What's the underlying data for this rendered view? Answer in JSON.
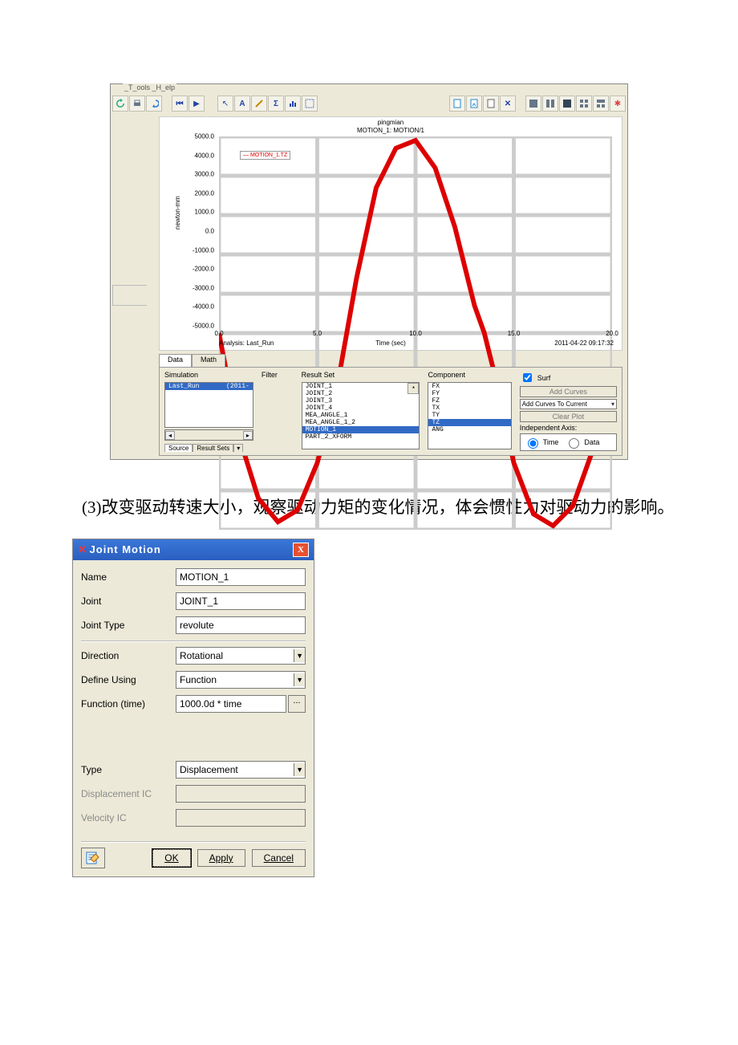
{
  "menufrag": "_T_ools  _H_elp",
  "chart_data": {
    "type": "line",
    "title": "pingmian",
    "subtitle": "MOTION_1: MOTION/1",
    "xlabel": "Time (sec)",
    "ylabel": "newton-mm",
    "xlim": [
      0,
      20
    ],
    "ylim": [
      -5000,
      5000
    ],
    "xticks": [
      0.0,
      5.0,
      10.0,
      15.0,
      20.0
    ],
    "yticks": [
      -5000.0,
      -4000.0,
      -3000.0,
      -2000.0,
      -1000.0,
      0.0,
      1000.0,
      2000.0,
      3000.0,
      4000.0,
      5000.0
    ],
    "series": [
      {
        "name": "MOTION_1.TZ",
        "color": "#d00000",
        "x": [
          0,
          1,
          2,
          3,
          4,
          5,
          6,
          6.5,
          7,
          8,
          9,
          10,
          11,
          12,
          13,
          13.5,
          14,
          15,
          16,
          17,
          18,
          19,
          20
        ],
        "y": [
          0,
          -2600,
          -4200,
          -4800,
          -4500,
          -3300,
          -1400,
          0,
          1400,
          3700,
          4700,
          4900,
          4200,
          2700,
          700,
          0,
          -1000,
          -3300,
          -4600,
          -4900,
          -4400,
          -3000,
          -1000
        ]
      }
    ],
    "legend": "MOTION_1.TZ",
    "analysis_label": "Analysis: Last_Run",
    "timestamp": "2011-04-22 09:17:32"
  },
  "tabs": {
    "data": "Data",
    "math": "Math"
  },
  "panel": {
    "sim_h": "Simulation",
    "filter_h": "Filter",
    "result_h": "Result Set",
    "comp_h": "Component",
    "sim_item": "Last_Run",
    "sim_date": "(2011-",
    "results": [
      "JOINT_1",
      "JOINT_2",
      "JOINT_3",
      "JOINT_4",
      "MEA_ANGLE_1",
      "MEA_ANGLE_1_2",
      "MOTION_1",
      "PART_2_XFORM"
    ],
    "results_sel": 6,
    "components": [
      "FX",
      "FY",
      "FZ",
      "TX",
      "TY",
      "TZ",
      "ANG"
    ],
    "components_sel": 5,
    "surf": "Surf",
    "add_curves": "Add Curves",
    "add_to_current": "Add Curves To Current",
    "clear_plot": "Clear Plot",
    "indep_axis": "Independent Axis:",
    "radio_time": "Time",
    "radio_data": "Data",
    "src": "Source",
    "src_sets": "Result Sets"
  },
  "para": "(3)改变驱动转速大小，观察驱动力矩的变化情况，体会惯性力对驱动力的影响。",
  "dialog": {
    "title": "Joint Motion",
    "name_l": "Name",
    "name_v": "MOTION_1",
    "joint_l": "Joint",
    "joint_v": "JOINT_1",
    "jtype_l": "Joint Type",
    "jtype_v": "revolute",
    "dir_l": "Direction",
    "dir_v": "Rotational",
    "def_l": "Define Using",
    "def_v": "Function",
    "func_l": "Function (time)",
    "func_v": "1000.0d * time",
    "type_l": "Type",
    "type_v": "Displacement",
    "dispic_l": "Displacement IC",
    "velic_l": "Velocity IC",
    "ok": "OK",
    "apply": "Apply",
    "cancel": "Cancel",
    "dots": "..."
  }
}
